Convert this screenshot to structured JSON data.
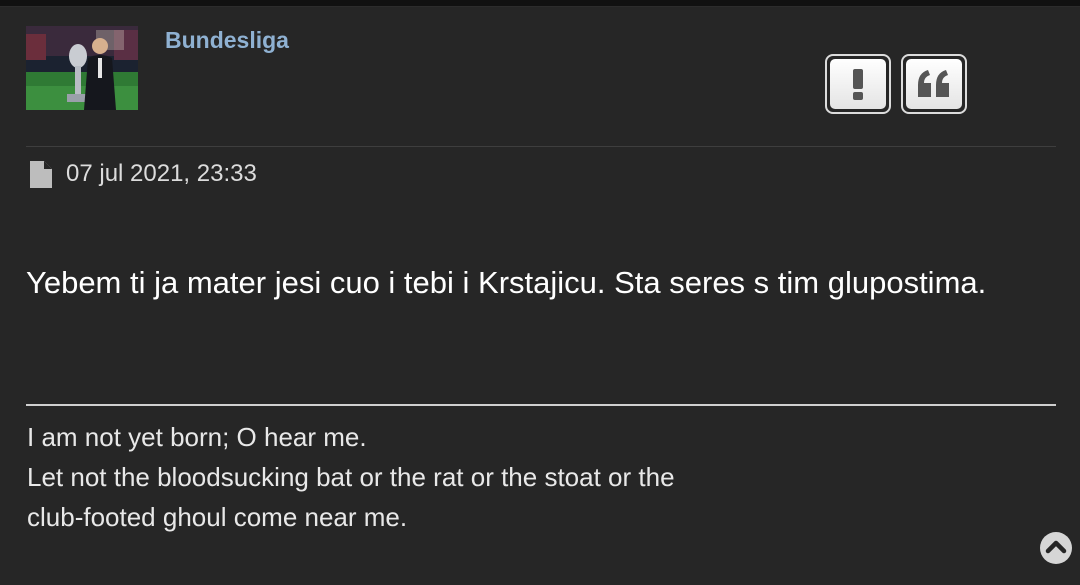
{
  "post": {
    "username": "Bundesliga",
    "avatar_alt": "",
    "date": "07 jul 2021, 23:33",
    "content": "Yebem ti ja mater jesi cuo i tebi i Krstajicu. Sta seres s tim glupostima.",
    "signature": [
      "I am not yet born; O hear me.",
      "Let not the bloodsucking bat or the rat or the stoat or the",
      "club-footed ghoul come near me."
    ]
  },
  "actions": {
    "report_icon": "exclamation-icon",
    "quote_icon": "quote-icon"
  },
  "colors": {
    "background": "#262626",
    "username": "#8fb1d2",
    "text": "#ffffff"
  }
}
